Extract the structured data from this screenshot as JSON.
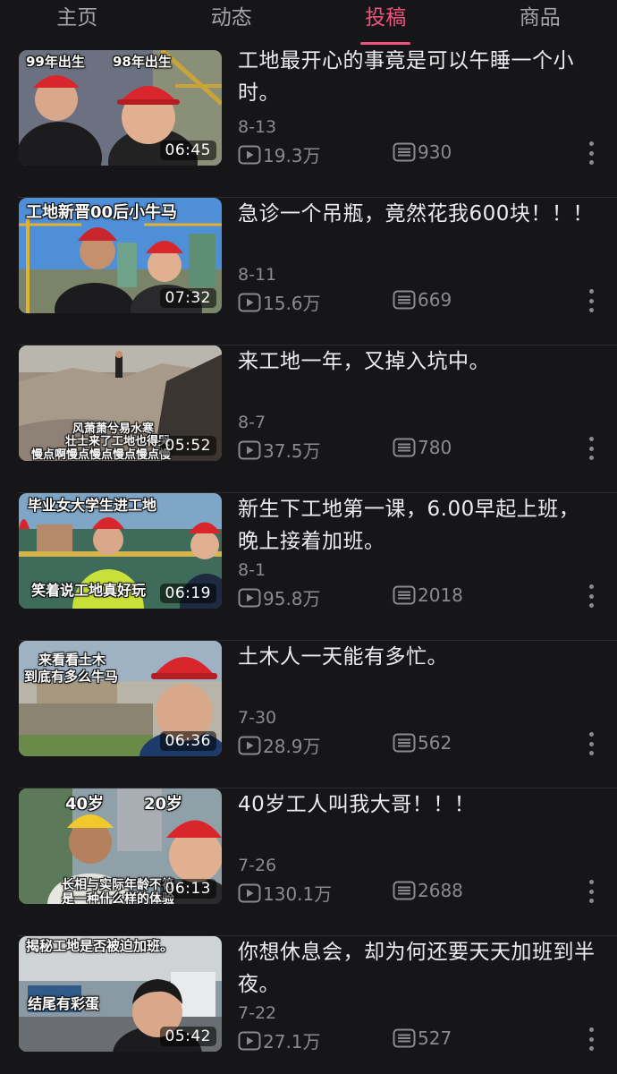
{
  "tabs": [
    {
      "label": "主页",
      "active": false
    },
    {
      "label": "动态",
      "active": false
    },
    {
      "label": "投稿",
      "active": true
    },
    {
      "label": "商品",
      "active": false
    }
  ],
  "accent_color": "#f0527e",
  "videos": [
    {
      "title": "工地最开心的事竟是可以午睡一个小时。",
      "date": "8-13",
      "plays": "19.3万",
      "comments": "930",
      "duration": "06:45",
      "captions": [
        "99年出生",
        "98年出生"
      ]
    },
    {
      "title": "急诊一个吊瓶，竟然花我600块！！！",
      "date": "8-11",
      "plays": "15.6万",
      "comments": "669",
      "duration": "07:32",
      "captions": [
        "工地新晋00后小牛马"
      ]
    },
    {
      "title": "来工地一年，又掉入坑中。",
      "date": "8-7",
      "plays": "37.5万",
      "comments": "780",
      "duration": "05:52",
      "captions": [
        "风萧萧兮易水寒",
        "壮士来了工地也得哭",
        "慢点啊慢点慢点慢点慢点慢"
      ]
    },
    {
      "title": "新生下工地第一课，6.00早起上班，晚上接着加班。",
      "date": "8-1",
      "plays": "95.8万",
      "comments": "2018",
      "duration": "06:19",
      "captions": [
        "毕业女大学生进工地",
        "笑着说工地真好玩"
      ]
    },
    {
      "title": "土木人一天能有多忙。",
      "date": "7-30",
      "plays": "28.9万",
      "comments": "562",
      "duration": "06:36",
      "captions": [
        "来看看土木",
        "到底有多么牛马"
      ]
    },
    {
      "title": "40岁工人叫我大哥！！！",
      "date": "7-26",
      "plays": "130.1万",
      "comments": "2688",
      "duration": "06:13",
      "captions": [
        "40岁",
        "20岁",
        "长相与实际年龄不符",
        "是一种什么样的体验"
      ]
    },
    {
      "title": "你想休息会，却为何还要天天加班到半夜。",
      "date": "7-22",
      "plays": "27.1万",
      "comments": "527",
      "duration": "05:42",
      "captions": [
        "揭秘工地是否被迫加班。",
        "结尾有彩蛋"
      ]
    }
  ]
}
